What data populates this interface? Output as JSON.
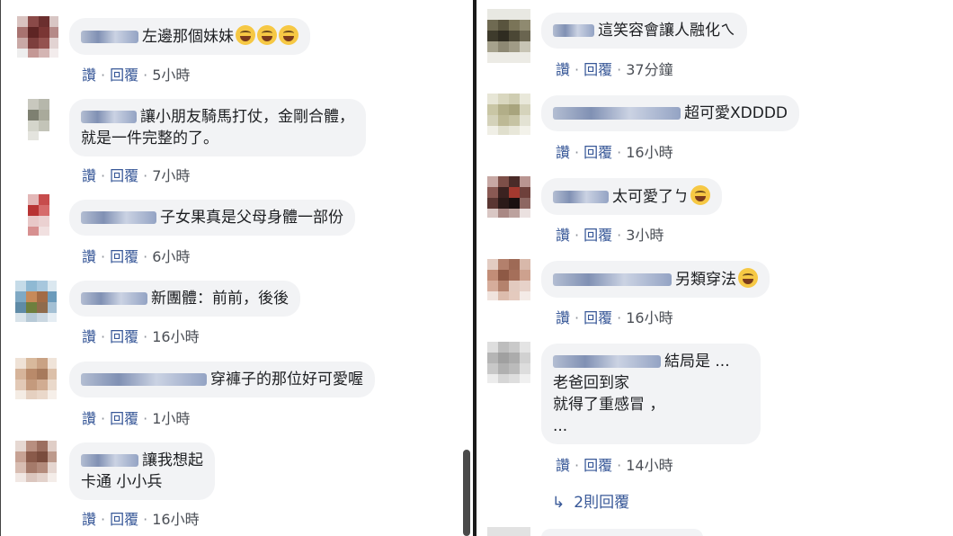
{
  "left_comments": [
    {
      "text": "左邊那個妹妹",
      "emojis": 3,
      "like": "讚",
      "reply": "回覆",
      "time": "5小時"
    },
    {
      "text": "讓小朋友騎馬打仗，金剛合體，",
      "text2": "就是一件完整的了。",
      "like": "讚",
      "reply": "回覆",
      "time": "7小時"
    },
    {
      "text": "子女果真是父母身體一部份",
      "like": "讚",
      "reply": "回覆",
      "time": "6小時"
    },
    {
      "text": "新團體：前前，後後",
      "like": "讚",
      "reply": "回覆",
      "time": "16小時"
    },
    {
      "text": "穿褲子的那位好可愛喔",
      "like": "讚",
      "reply": "回覆",
      "time": "1小時"
    },
    {
      "text": "讓我想起",
      "text2": "卡通 小小兵",
      "like": "讚",
      "reply": "回覆",
      "time": "16小時"
    }
  ],
  "right_comments": [
    {
      "text": "這笑容會讓人融化ㄟ",
      "like": "讚",
      "reply": "回覆",
      "time": "37分鐘"
    },
    {
      "text": "超可愛XDDDD",
      "like": "讚",
      "reply": "回覆",
      "time": "16小時"
    },
    {
      "text": "太可愛了ㄅ",
      "emojis": 1,
      "like": "讚",
      "reply": "回覆",
      "time": "3小時"
    },
    {
      "text": "另類穿法",
      "emojis": 1,
      "like": "讚",
      "reply": "回覆",
      "time": "16小時"
    },
    {
      "text": "結局是 ...",
      "text2": "老爸回到家",
      "text3": "就得了重感冒 ，",
      "text4": "...",
      "like": "讚",
      "reply": "回覆",
      "time": "14小時"
    }
  ],
  "replies": {
    "label": "2則回覆",
    "icon": "reply-arrow-icon"
  },
  "colors": {
    "bubble": "#f2f3f5",
    "link": "#385898",
    "meta": "#4b4f56"
  }
}
